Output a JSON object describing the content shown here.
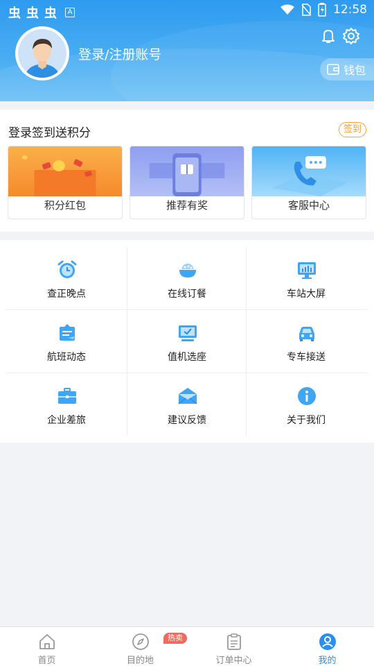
{
  "status": {
    "left_glyphs": [
      "虫",
      "虫",
      "虫"
    ],
    "notification_badge": "A",
    "time": "12:58"
  },
  "header": {
    "login_text": "登录/注册账号",
    "wallet_label": "钱包"
  },
  "signin": {
    "title": "登录签到送积分",
    "button": "签到",
    "promos": [
      {
        "label": "积分红包",
        "icon": "red-packet-illustration"
      },
      {
        "label": "推荐有奖",
        "icon": "phone-gift-illustration"
      },
      {
        "label": "客服中心",
        "icon": "phone-chat-illustration"
      }
    ]
  },
  "grid": {
    "items": [
      {
        "label": "查正晚点",
        "icon": "alarm-clock-icon"
      },
      {
        "label": "在线订餐",
        "icon": "food-bowl-icon"
      },
      {
        "label": "车站大屏",
        "icon": "station-screen-icon"
      },
      {
        "label": "航班动态",
        "icon": "flight-ticket-icon"
      },
      {
        "label": "值机选座",
        "icon": "checkin-seat-icon"
      },
      {
        "label": "专车接送",
        "icon": "car-icon"
      },
      {
        "label": "企业差旅",
        "icon": "briefcase-icon"
      },
      {
        "label": "建议反馈",
        "icon": "mail-icon"
      },
      {
        "label": "关于我们",
        "icon": "info-icon"
      }
    ]
  },
  "nav": {
    "items": [
      {
        "label": "首页",
        "icon": "home-icon"
      },
      {
        "label": "目的地",
        "icon": "compass-icon"
      },
      {
        "label": "订单中心",
        "icon": "clipboard-icon"
      },
      {
        "label": "我的",
        "icon": "user-icon"
      }
    ],
    "hot_badge": "热卖",
    "active_color": "#2b8ff0",
    "inactive_color": "#888888"
  },
  "colors": {
    "header_blue": "#2e9bf0",
    "accent_orange": "#f2a23a",
    "icon_blue": "#3fa5f5"
  }
}
